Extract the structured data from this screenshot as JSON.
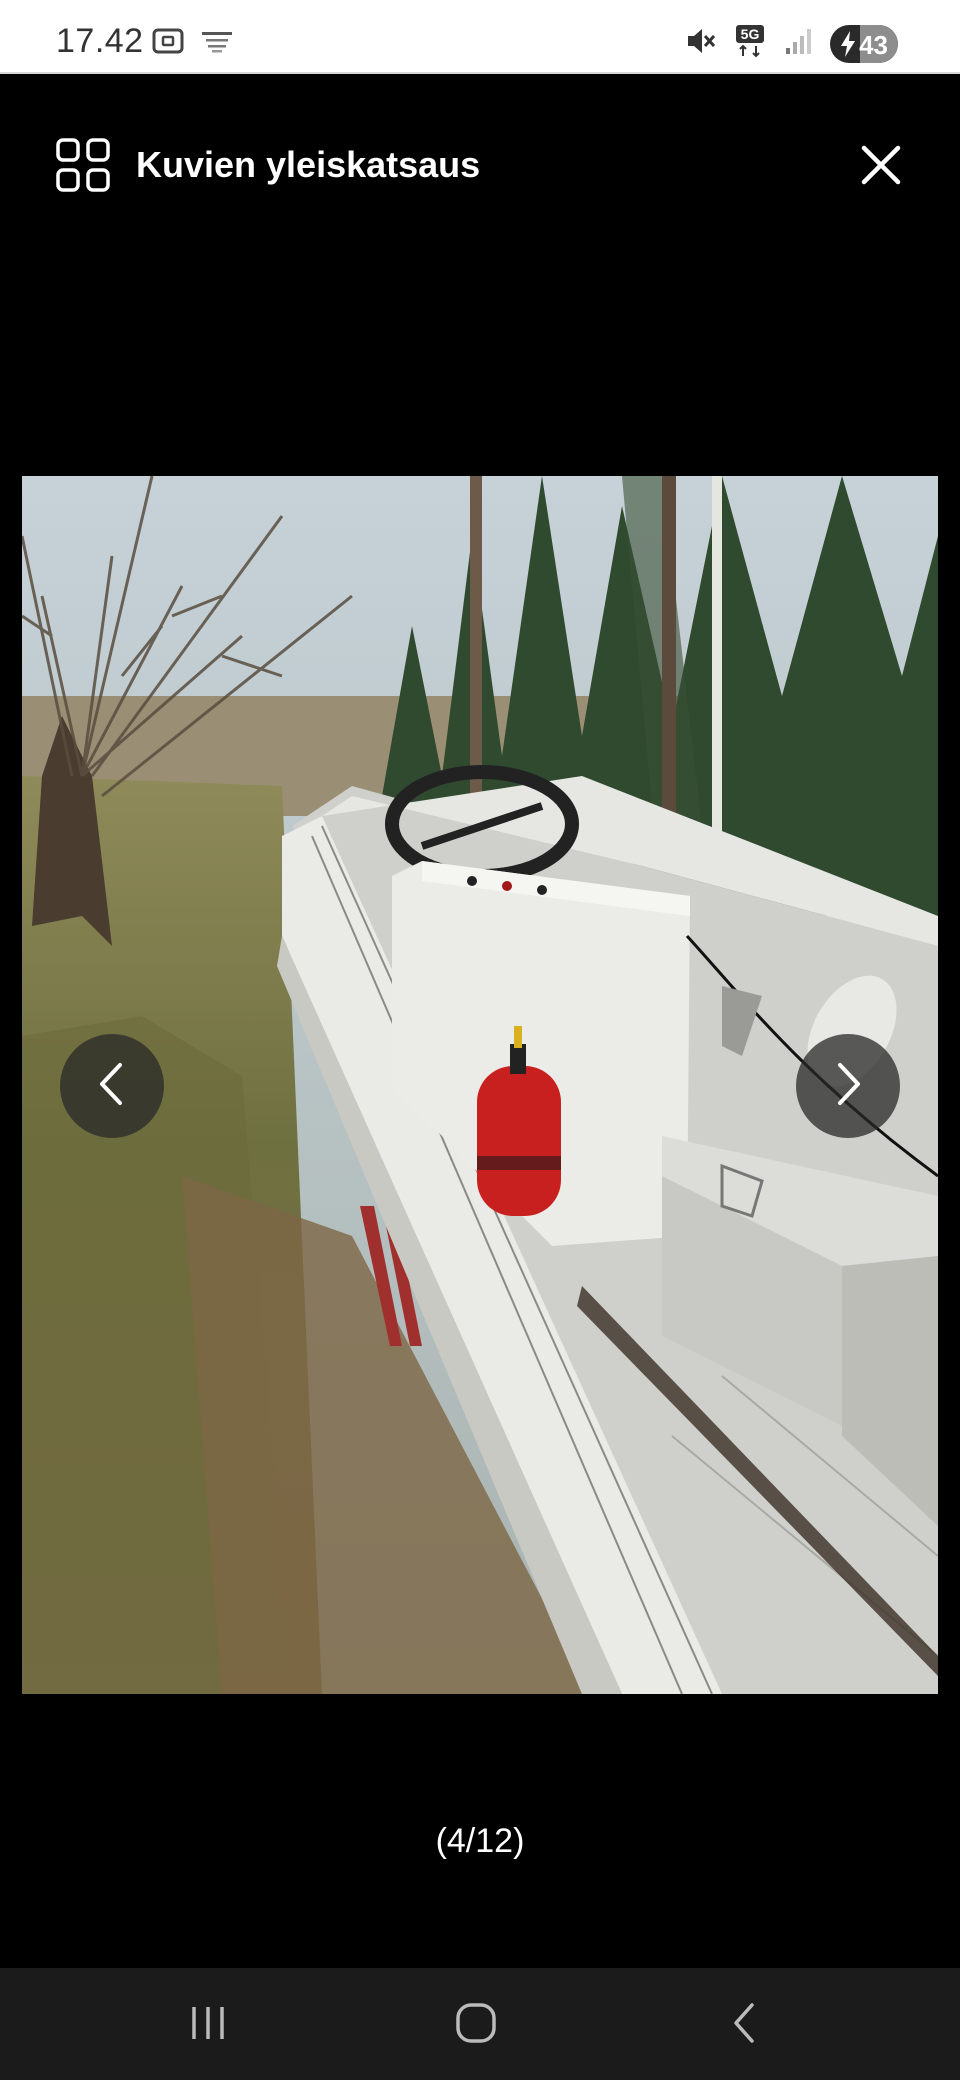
{
  "status_bar": {
    "time": "17.42",
    "battery_level": "43",
    "network": "5G",
    "icons": [
      "screenshot-icon",
      "app-badge-icon",
      "mute-icon",
      "network-5g-icon",
      "signal-icon",
      "battery-charging-icon"
    ]
  },
  "header": {
    "title": "Kuvien yleiskatsaus",
    "grid_icon": "grid-icon",
    "close_icon": "close-icon"
  },
  "gallery": {
    "counter": "(4/12)",
    "prev_icon": "chevron-left-icon",
    "next_icon": "chevron-right-icon"
  },
  "navigation_bar": {
    "icons": [
      "recent-apps-icon",
      "home-icon",
      "back-icon"
    ]
  },
  "colors": {
    "background": "#000000",
    "status_bar": "#ffffff",
    "navbar": "#1b1b1b"
  }
}
